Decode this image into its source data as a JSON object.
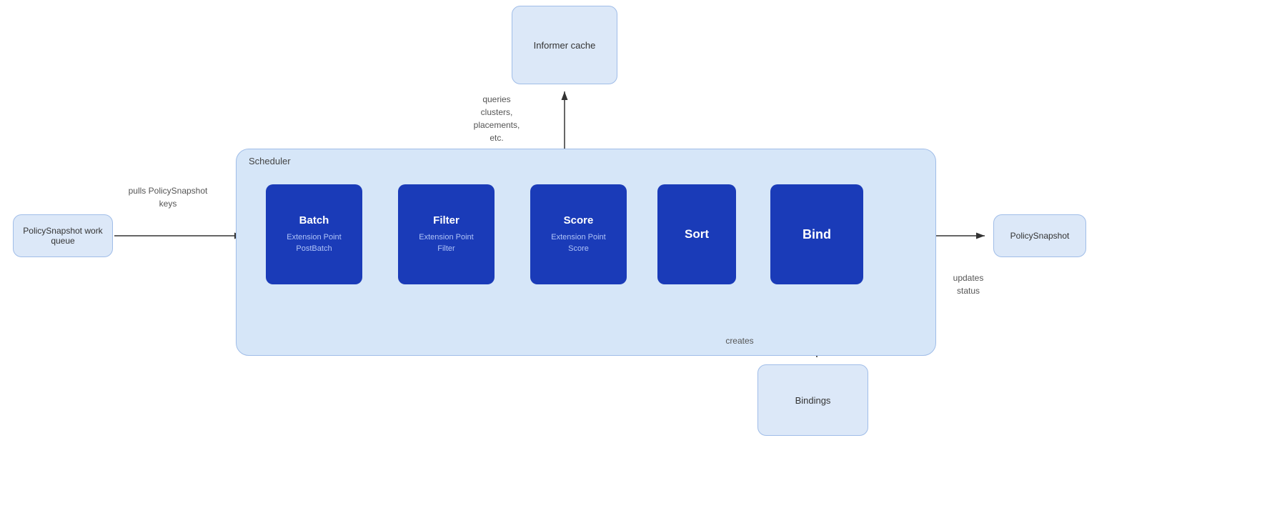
{
  "informer_cache": {
    "label": "Informer cache"
  },
  "scheduler": {
    "label": "Scheduler"
  },
  "steps": [
    {
      "id": "batch",
      "title": "Batch",
      "subtitle": "Extension Point\nPostBatch"
    },
    {
      "id": "filter",
      "title": "Filter",
      "subtitle": "Extension Point\nFilter"
    },
    {
      "id": "score",
      "title": "Score",
      "subtitle": "Extension Point\nScore"
    },
    {
      "id": "sort",
      "title": "Sort",
      "subtitle": ""
    },
    {
      "id": "bind",
      "title": "Bind",
      "subtitle": ""
    }
  ],
  "policy_queue": {
    "label": "PolicySnapshot work queue"
  },
  "policy_output": {
    "label": "PolicySnapshot"
  },
  "bindings": {
    "label": "Bindings"
  },
  "annotations": {
    "pulls": "pulls\nPolicySnapshot\nkeys",
    "queries": "queries\nclusters,\nplacements,\netc.",
    "creates": "creates",
    "updates": "updates\nstatus"
  },
  "colors": {
    "box_bg": "#dce8f8",
    "box_border": "#a0bde8",
    "step_bg": "#1a3bb8",
    "scheduler_bg": "#d6e6f8",
    "arrow": "#333333"
  }
}
